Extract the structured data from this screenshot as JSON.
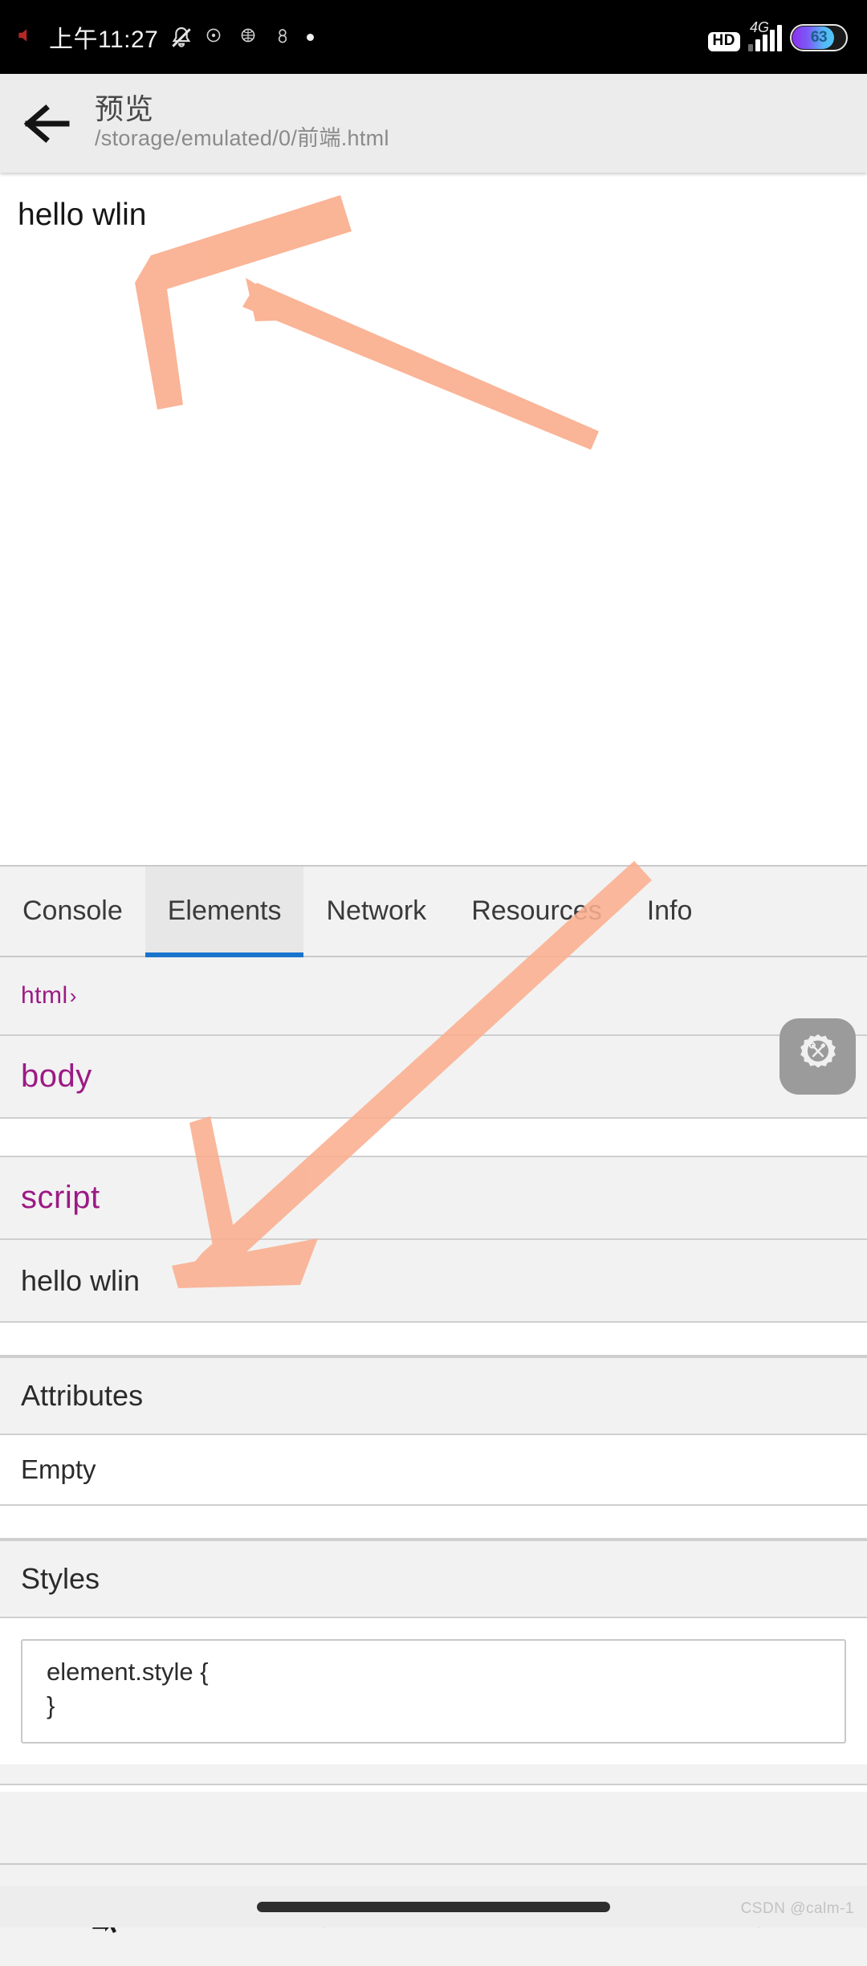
{
  "statusbar": {
    "clock": "上午11:27",
    "mute_icon": "bell-muted-icon",
    "app_icons": [
      "app-icon-1",
      "app-icon-2",
      "app-icon-3"
    ],
    "dot_icon": "dot-icon",
    "hd_label": "HD",
    "network_label": "4G",
    "signal_icon": "signal-bars-icon",
    "battery_percent": "63"
  },
  "appbar": {
    "back_icon": "back-arrow-icon",
    "title": "预览",
    "subtitle": "/storage/emulated/0/前端.html"
  },
  "preview": {
    "body_text": "hello wlin"
  },
  "devtools": {
    "tabs": [
      {
        "label": "Console",
        "active": false
      },
      {
        "label": "Elements",
        "active": true
      },
      {
        "label": "Network",
        "active": false
      },
      {
        "label": "Resources",
        "active": false
      },
      {
        "label": "Info",
        "active": false
      }
    ],
    "dom_rows": [
      {
        "label": "html",
        "chevron": "›",
        "type": "tag"
      },
      {
        "label": "body",
        "chevron": "",
        "type": "tag"
      },
      {
        "label": "",
        "chevron": "",
        "type": "selected-blank"
      },
      {
        "label": "script",
        "chevron": "",
        "type": "tag"
      },
      {
        "label": "hello wlin",
        "chevron": "",
        "type": "text"
      }
    ],
    "attributes_header": "Attributes",
    "attributes_value": "Empty",
    "styles_header": "Styles",
    "style_rule_open": "element.style {",
    "style_rule_close": "}",
    "fab_icon": "gear-tools-icon"
  },
  "bottombar": {
    "buttons": [
      {
        "icon": "inspect-element-icon",
        "name": "inspect"
      },
      {
        "icon": "refresh-icon",
        "name": "refresh"
      },
      {
        "icon": "eye-icon",
        "name": "preview-toggle"
      },
      {
        "icon": "undo-rotate-icon",
        "name": "reload"
      }
    ]
  },
  "gesture": {
    "home_indicator": "home-pill"
  },
  "watermark": {
    "text": "CSDN @calm-1"
  },
  "colors": {
    "accent_blue": "#1a73cc",
    "tag_purple": "#9c1a85",
    "annotation_salmon": "#faae8e",
    "appbar_bg": "#ececec",
    "panel_bg": "#f2f2f2"
  }
}
